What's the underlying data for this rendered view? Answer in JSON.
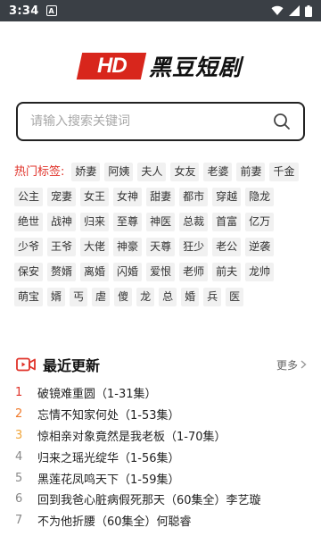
{
  "status_bar": {
    "time": "3:34",
    "notification_icon": "android-notification-icon",
    "wifi_icon": "wifi-icon",
    "signal_icon": "signal-icon",
    "battery_icon": "battery-icon"
  },
  "logo": {
    "badge": "HD",
    "name": "黑豆短剧",
    "brand_color": "#d8261c"
  },
  "search": {
    "placeholder": "请输入搜索关键词",
    "value": ""
  },
  "tags": {
    "label": "热门标签:",
    "items": [
      "娇妻",
      "阿姨",
      "夫人",
      "女友",
      "老婆",
      "前妻",
      "千金",
      "公主",
      "宠妻",
      "女王",
      "女神",
      "甜妻",
      "都市",
      "穿越",
      "隐龙",
      "绝世",
      "战神",
      "归来",
      "至尊",
      "神医",
      "总裁",
      "首富",
      "亿万",
      "少爷",
      "王爷",
      "大佬",
      "神豪",
      "天尊",
      "狂少",
      "老公",
      "逆袭",
      "保安",
      "赘婿",
      "离婚",
      "闪婚",
      "爱恨",
      "老师",
      "前夫",
      "龙帅",
      "萌宝",
      "婿",
      "丐",
      "虐",
      "傻",
      "龙",
      "总",
      "婚",
      "兵",
      "医"
    ]
  },
  "recent": {
    "title": "最近更新",
    "more": "更多",
    "items": [
      {
        "rank": "1",
        "title": "破镜难重圆（1-31集）"
      },
      {
        "rank": "2",
        "title": "忘情不知家何处（1-53集）"
      },
      {
        "rank": "3",
        "title": "惊相亲对象竟然是我老板（1-70集）"
      },
      {
        "rank": "4",
        "title": "归来之瑶光绽华（1-56集）"
      },
      {
        "rank": "5",
        "title": "黑莲花凤鸣天下（1-59集）"
      },
      {
        "rank": "6",
        "title": "回到我爸心脏病假死那天（60集全）李艺璇"
      },
      {
        "rank": "7",
        "title": "不为他折腰（60集全）何聪睿"
      }
    ]
  }
}
